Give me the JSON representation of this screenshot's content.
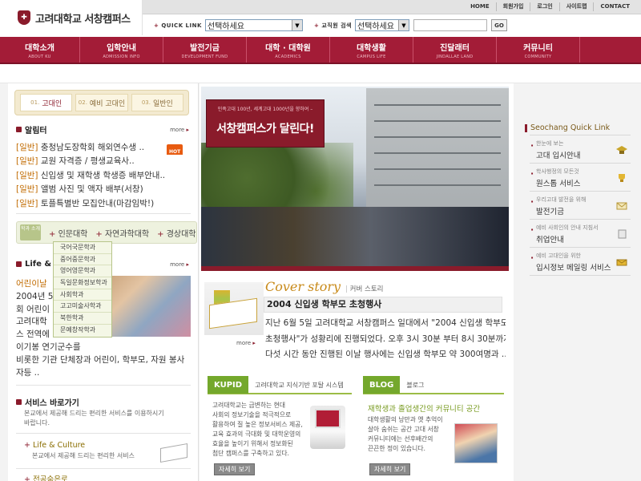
{
  "logo": {
    "text": "고려대학교 서창캠퍼스"
  },
  "utility_nav": [
    "HOME",
    "회원가입",
    "로그인",
    "사이트맵",
    "CONTACT"
  ],
  "quick_link": {
    "label": "QUICK LINK",
    "value": "선택하세요"
  },
  "staff_search": {
    "label": "교직원 검색",
    "value": "선택하세요",
    "button": "GO"
  },
  "main_nav": [
    {
      "ko": "대학소개",
      "en": "ABOUT KU"
    },
    {
      "ko": "입학안내",
      "en": "ADMISSION INFO"
    },
    {
      "ko": "발전기금",
      "en": "DEVELOPMENT FUND"
    },
    {
      "ko": "대학 · 대학원",
      "en": "ACADEMICS"
    },
    {
      "ko": "대학생활",
      "en": "CAMPUS LIFE"
    },
    {
      "ko": "진달래터",
      "en": "JINDALLAE LAND"
    },
    {
      "ko": "커뮤니티",
      "en": "COMMUNITY"
    }
  ],
  "admission_tabs": [
    {
      "num": "01.",
      "label": "고대인"
    },
    {
      "num": "02.",
      "label": "예비 고대인"
    },
    {
      "num": "03.",
      "label": "일반인"
    }
  ],
  "notice": {
    "title": "알림터",
    "more": "more",
    "hot": "HOT",
    "items": [
      {
        "tag": "[일반]",
        "text": "충청남도장학회 해외연수생 .."
      },
      {
        "tag": "[일반]",
        "text": "교원 자격증 / 평생교육사.."
      },
      {
        "tag": "[일반]",
        "text": "신입생 및 재학생 학생증 배부안내.."
      },
      {
        "tag": "[일반]",
        "text": "앨범 사진 및 액자 배부(서창)"
      },
      {
        "tag": "[일반]",
        "text": "토플특별반 모집안내(마감임박!)"
      }
    ]
  },
  "departments": {
    "badge": "학과 소개",
    "items": [
      "인문대학",
      "자연과학대학",
      "경상대학"
    ],
    "dropdown": [
      "국어국문학과",
      "중어중문학과",
      "영어영문학과",
      "독일문화정보학과",
      "사회학과",
      "고고미술사학과",
      "북한학과",
      "문예창작학과"
    ]
  },
  "life": {
    "title": "Life & Culture",
    "more": "more",
    "lines": [
      "어린이날",
      "2004년 5",
      "회 어린이",
      "고려대학",
      "스 전역에",
      "이기봉 연기군수를",
      "비롯한 기관 단체장과 어린이, 학부모, 자원 봉사",
      "자등 .."
    ]
  },
  "services": {
    "title": "서비스 바로가기",
    "subtitle_lines": [
      "본교에서 제공해 드리는 편리한 서비스를 이용하시기",
      "바랍니다."
    ],
    "items": [
      {
        "title": "Life & Culture",
        "desc": "본교에서 제공해 드리는 편리한 서비스"
      },
      {
        "title": "전공숨은로",
        "desc": ""
      }
    ]
  },
  "hero": {
    "small": "민족고대 100년, 세계고대 1000년을 향하여 –",
    "big": "서창캠퍼스가 달린다!"
  },
  "cover_story": {
    "title": "Cover story",
    "subtitle": "커버 스토리",
    "headline": "2004 신입생 학부모 초청행사",
    "more": "more",
    "body": [
      "지난 6월 5일 고려대학교 서창캠퍼스 일대에서 \"2004 신입생 학부모",
      "초청행사\"가 성황리에 진행되었다. 오후 3시 30분 부터 8시 30분까지",
      "다섯 시간 동안 진행된 이날 행사에는 신입생 학부모 약 300여명과 .."
    ]
  },
  "kupid": {
    "label": "KUPID",
    "desc": "고려대학교 지식기반 포탈 시스템",
    "body": [
      "고려대학교는 급변하는 현대",
      "사회의 정보기술을 적극적으로",
      "활용하여 질 높은 정보서비스 제공,",
      "교육 효과의 극대화 및 대학운영의",
      "효율을 높이기 위해서 정보화된",
      "첨단 캠퍼스를 구축하고 있다."
    ],
    "button": "자세히 보기"
  },
  "blog": {
    "label": "BLOG",
    "desc": "블로그",
    "title": "재학생과 졸업생간의 커뮤니티 공간",
    "body": [
      "대학생활의 낭만과 옛 추억이",
      "살아 숨쉬는 공간 고대 서창",
      "커뮤니티에는 선후배간의",
      "끈끈한 정이 있습니다."
    ],
    "button": "자세히 보기"
  },
  "quick_menu": {
    "title": "Seochang Quick Link",
    "items": [
      {
        "small": "한눈에 보는",
        "main": "고대 입시안내",
        "icon": "cap-icon"
      },
      {
        "small": "학사행정의 모든것",
        "main": "원스톱 서비스",
        "icon": "trophy-icon"
      },
      {
        "small": "우리고대 발전을 위해",
        "main": "발전기금",
        "icon": "envelope-icon"
      },
      {
        "small": "예비 사회인의 안내 지침서",
        "main": "취업안내",
        "icon": "document-icon"
      },
      {
        "small": "예비 고대인을 위한",
        "main": "입시정보 메일링 서비스",
        "icon": "mail-icon"
      }
    ]
  },
  "colors": {
    "brand": "#a31c37",
    "accent_green": "#74a82c",
    "accent_gold": "#c88a1a"
  }
}
